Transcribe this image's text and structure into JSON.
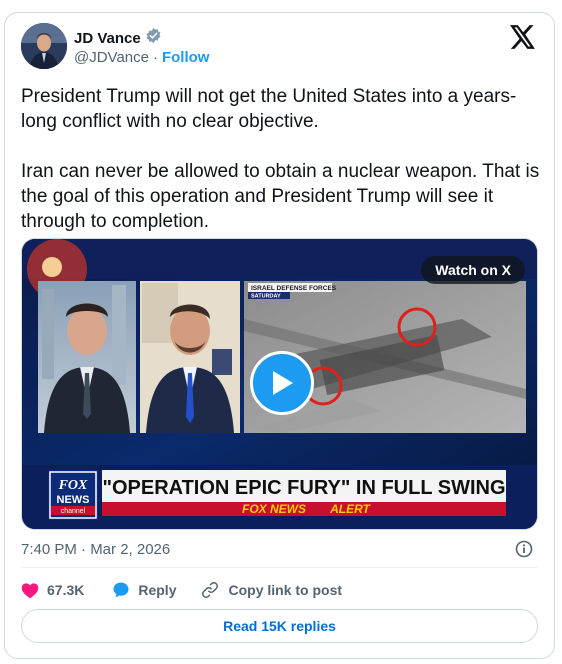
{
  "author": {
    "name": "JD Vance",
    "handle": "@JDVance",
    "separator": "·",
    "follow_label": "Follow",
    "verified_icon": "verified-badge-icon",
    "verified_color": "#829aab"
  },
  "platform_icon": "x-logo-icon",
  "tweet": {
    "paragraphs": [
      "President Trump will not get the United States into a years-long conflict with no clear objective.",
      "Iran can never be allowed to obtain a nuclear weapon. That is the goal of this operation and President Trump will see it through to completion."
    ]
  },
  "media": {
    "watch_label": "Watch on X",
    "play_icon": "play-icon",
    "tv": {
      "source_tag": "ISRAEL DEFENSE FORCES",
      "source_day": "SATURDAY",
      "headline": "\"OPERATION EPIC FURY\" IN FULL SWING",
      "network_logo_top": "FOX",
      "network_logo_mid": "NEWS",
      "network_logo_bottom": "channel",
      "alert_brand": "FOX NEWS",
      "alert_word": "ALERT"
    }
  },
  "timestamp": "7:40 PM · Mar 2, 2026",
  "actions": {
    "likes": "67.3K",
    "reply_label": "Reply",
    "copy_label": "Copy link to post"
  },
  "read_replies_label": "Read 15K replies",
  "colors": {
    "accent": "#1d9bf0",
    "like": "#f91880",
    "link": "#006fd6",
    "muted": "#536471"
  }
}
